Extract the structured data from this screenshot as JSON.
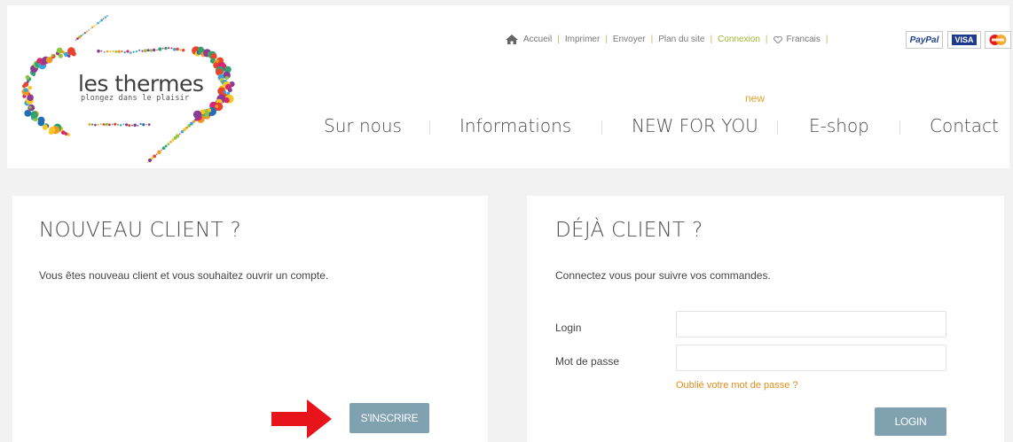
{
  "brand": {
    "name": "les thermes",
    "tagline": "plongez dans le plaisir"
  },
  "top_links": {
    "home": "Accueil",
    "print": "Imprimer",
    "send": "Envoyer",
    "sitemap": "Plan du site",
    "login": "Connexion",
    "language": "Francais"
  },
  "payments": {
    "paypal": "PayPal",
    "visa": "VISA",
    "mastercard_icon": "mastercard-icon"
  },
  "nav": {
    "badge_new": "new",
    "items": [
      "Sur nous",
      "Informations",
      "NEW FOR YOU",
      "E-shop",
      "Contact"
    ]
  },
  "new_client": {
    "title": "NOUVEAU CLIENT ?",
    "description": "Vous êtes nouveau client et vous souhaitez ouvrir un compte.",
    "button": "S'INSCRIRE"
  },
  "existing_client": {
    "title": "DÉJÀ CLIENT ?",
    "description": "Connectez vous pour suivre vos commandes.",
    "login_label": "Login",
    "login_value": "",
    "password_label": "Mot de passe",
    "password_value": "",
    "forgot": "Oublié votre mot de passe ?",
    "button": "LOGIN"
  },
  "colors": {
    "accent_orange": "#e08d1b",
    "button": "#7fa1b0",
    "active_link": "#9ab82f",
    "annotation_arrow": "#e8141b"
  }
}
